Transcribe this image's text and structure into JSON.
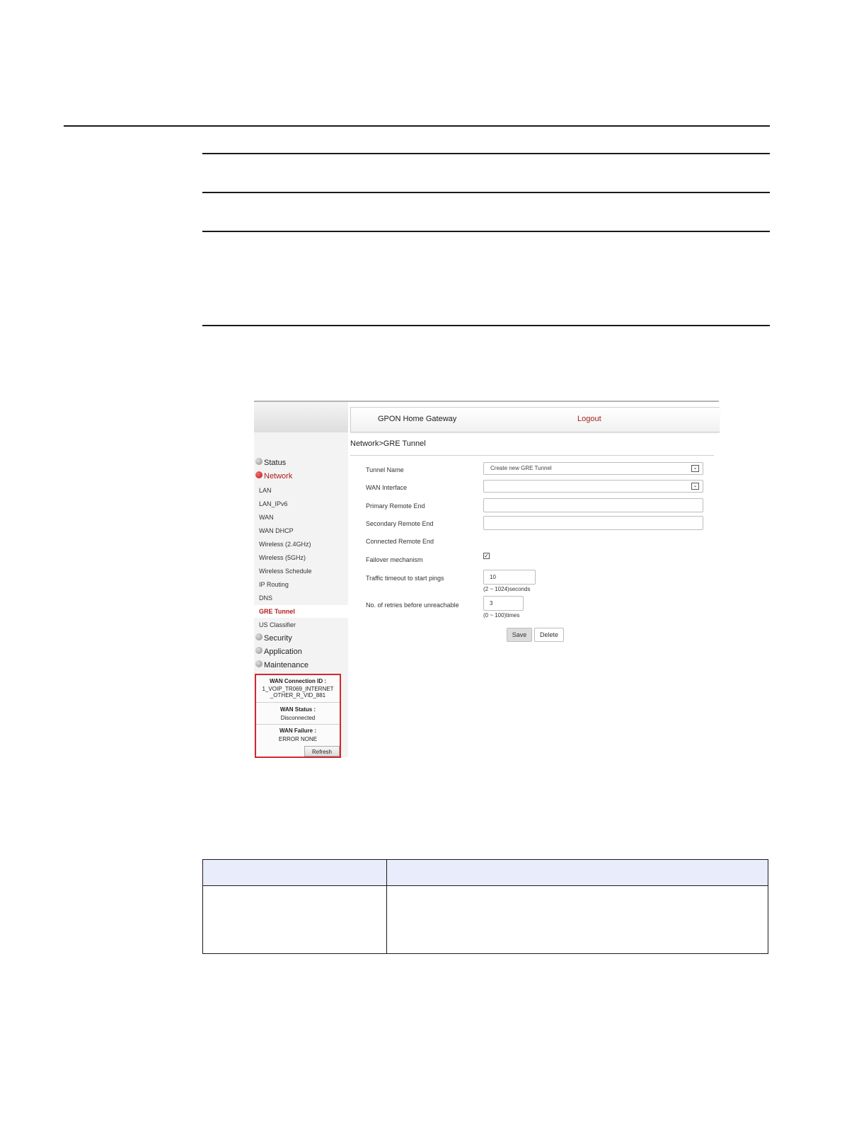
{
  "header": {
    "app_title": "GPON Home Gateway",
    "logout_label": "Logout"
  },
  "breadcrumb": "Network>GRE Tunnel",
  "sidebar": {
    "sections": [
      {
        "label": "Status"
      },
      {
        "label": "Network"
      },
      {
        "label": "Security"
      },
      {
        "label": "Application"
      },
      {
        "label": "Maintenance"
      }
    ],
    "network_items": [
      {
        "label": "LAN"
      },
      {
        "label": "LAN_IPv6"
      },
      {
        "label": "WAN"
      },
      {
        "label": "WAN DHCP"
      },
      {
        "label": "Wireless (2.4GHz)"
      },
      {
        "label": "Wireless (5GHz)"
      },
      {
        "label": "Wireless Schedule"
      },
      {
        "label": "IP Routing"
      },
      {
        "label": "DNS"
      },
      {
        "label": "GRE Tunnel"
      },
      {
        "label": "US Classifier"
      }
    ]
  },
  "status_box": {
    "wan_conn_title": "WAN Connection ID :",
    "wan_conn_value_line1": "1_VOIP_TR069_INTERNET",
    "wan_conn_value_line2": "_OTHER_R_VID_881",
    "wan_status_title": "WAN Status :",
    "wan_status_value": "Disconnected",
    "wan_failure_title": "WAN Failure :",
    "wan_failure_value": "ERROR NONE",
    "refresh_label": "Refresh"
  },
  "form": {
    "tunnel_name_label": "Tunnel Name",
    "tunnel_name_value": "Create new GRE Tunnel",
    "wan_interface_label": "WAN Interface",
    "wan_interface_value": "",
    "primary_remote_label": "Primary Remote End",
    "primary_remote_value": "",
    "secondary_remote_label": "Secondary Remote End",
    "secondary_remote_value": "",
    "connected_remote_label": "Connected Remote End",
    "failover_label": "Failover mechanism",
    "failover_checked": true,
    "traffic_timeout_label": "Traffic timeout to start pings",
    "traffic_timeout_value": "10",
    "traffic_timeout_hint": "(2 ~ 1024)seconds",
    "retries_label": "No. of retries before unreachable",
    "retries_value": "3",
    "retries_hint": "(0 ~ 100)times",
    "save_label": "Save",
    "delete_label": "Delete"
  },
  "colors": {
    "accent_red": "#b01c1c",
    "status_box_border": "#d2282d",
    "table_header_bg": "#e8ecfb"
  }
}
